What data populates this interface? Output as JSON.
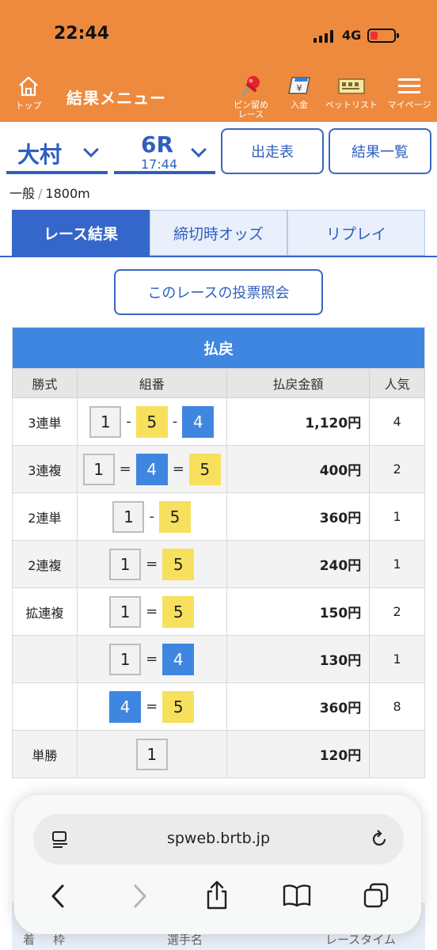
{
  "status": {
    "time": "22:44",
    "network": "4G"
  },
  "nav": {
    "home": "トップ",
    "title": "結果メニュー",
    "pin_line1": "ピン留め",
    "pin_line2": "レース",
    "deposit": "入金",
    "betlist": "ベットリスト",
    "mypage": "マイページ"
  },
  "selector": {
    "venue": "大村",
    "race": "6R",
    "race_time": "17:44",
    "entry_button": "出走表",
    "results_button": "結果一覧"
  },
  "race_info": {
    "grade": "一般",
    "distance": "1800m"
  },
  "tabs": [
    "レース結果",
    "締切時オッズ",
    "リプレイ"
  ],
  "vote_button": "このレースの投票照会",
  "payout": {
    "caption": "払戻",
    "headers": [
      "勝式",
      "組番",
      "払戻金額",
      "人気"
    ],
    "rows": [
      {
        "type": "3連単",
        "nums": [
          "1",
          "5",
          "4"
        ],
        "sep": "-",
        "amount": "1,120円",
        "pop": "4"
      },
      {
        "type": "3連複",
        "nums": [
          "1",
          "4",
          "5"
        ],
        "sep": "=",
        "amount": "400円",
        "pop": "2"
      },
      {
        "type": "2連単",
        "nums": [
          "1",
          "5"
        ],
        "sep": "-",
        "amount": "360円",
        "pop": "1"
      },
      {
        "type": "2連複",
        "nums": [
          "1",
          "5"
        ],
        "sep": "=",
        "amount": "240円",
        "pop": "1"
      },
      {
        "type": "拡連複",
        "nums": [
          "1",
          "5"
        ],
        "sep": "=",
        "amount": "150円",
        "pop": "2"
      },
      {
        "type": "",
        "nums": [
          "1",
          "4"
        ],
        "sep": "=",
        "amount": "130円",
        "pop": "1"
      },
      {
        "type": "",
        "nums": [
          "4",
          "5"
        ],
        "sep": "=",
        "amount": "360円",
        "pop": "8"
      },
      {
        "type": "単勝",
        "nums": [
          "1"
        ],
        "sep": "",
        "amount": "120円",
        "pop": ""
      }
    ]
  },
  "bottom_headers": {
    "rank": "着",
    "frame": "枠",
    "racer": "選手名",
    "time": "レースタイム"
  },
  "browser": {
    "url": "spweb.brtb.jp"
  }
}
